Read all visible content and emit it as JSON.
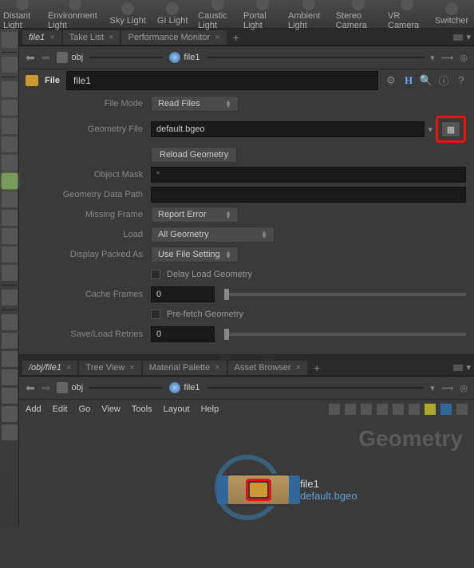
{
  "shelf": [
    {
      "label": "Distant Light"
    },
    {
      "label": "Environment Light"
    },
    {
      "label": "Sky Light"
    },
    {
      "label": "GI Light"
    },
    {
      "label": "Caustic Light"
    },
    {
      "label": "Portal Light"
    },
    {
      "label": "Ambient Light"
    },
    {
      "label": "Stereo Camera"
    },
    {
      "label": "VR Camera"
    },
    {
      "label": "Switcher"
    }
  ],
  "top_tabs": {
    "active": "file1",
    "others": [
      "Take List",
      "Performance Monitor"
    ]
  },
  "path": {
    "seg1": "obj",
    "seg2": "file1"
  },
  "node_header": {
    "label": "File",
    "value": "file1"
  },
  "params": {
    "file_mode": {
      "label": "File Mode",
      "value": "Read Files"
    },
    "geometry_file": {
      "label": "Geometry File",
      "value": "default.bgeo"
    },
    "reload": "Reload Geometry",
    "object_mask": {
      "label": "Object Mask",
      "placeholder": "*"
    },
    "geom_path": {
      "label": "Geometry Data Path",
      "value": ""
    },
    "missing_frame": {
      "label": "Missing Frame",
      "value": "Report Error"
    },
    "load": {
      "label": "Load",
      "value": "All Geometry"
    },
    "display_packed": {
      "label": "Display Packed As",
      "value": "Use File Setting"
    },
    "delay_load": "Delay Load Geometry",
    "cache_frames": {
      "label": "Cache Frames",
      "value": "0"
    },
    "prefetch": "Pre-fetch Geometry",
    "save_retries": {
      "label": "Save/Load Retries",
      "value": "0"
    }
  },
  "net_tabs": {
    "active": "/obj/file1",
    "others": [
      "Tree View",
      "Material Palette",
      "Asset Browser"
    ]
  },
  "menubar": [
    "Add",
    "Edit",
    "Go",
    "View",
    "Tools",
    "Layout",
    "Help"
  ],
  "network": {
    "title": "Geometry",
    "node_name": "file1",
    "node_file": "default.bgeo"
  }
}
